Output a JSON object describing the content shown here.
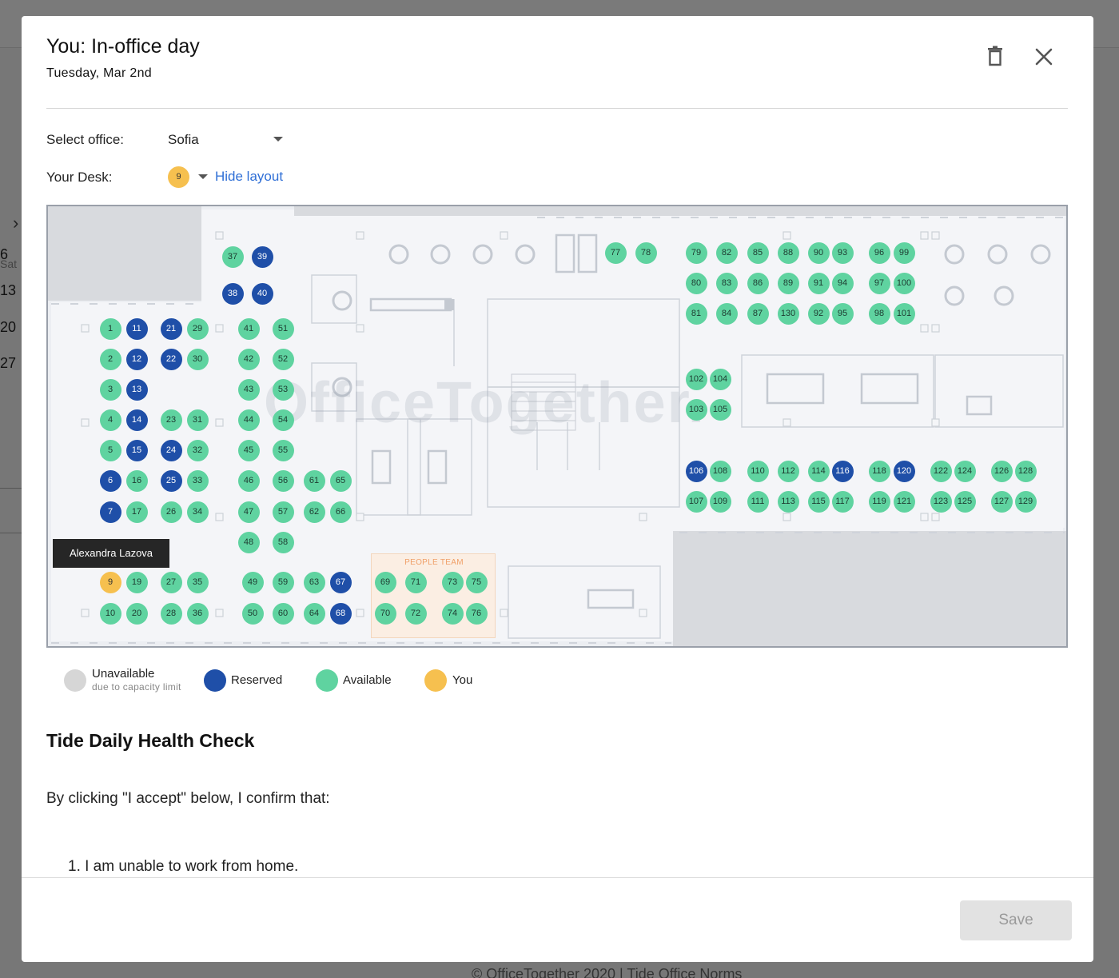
{
  "background": {
    "weekday": "Sat",
    "dates": [
      "6",
      "13",
      "20",
      "27"
    ],
    "footer": "© OfficeTogether 2020 | Tide Office Norms"
  },
  "modal": {
    "title": "You: In-office day",
    "date": "Tuesday, Mar 2nd",
    "office_label": "Select office:",
    "office_value": "Sofia",
    "desk_label": "Your Desk:",
    "desk_value": "9",
    "hide_layout": "Hide layout"
  },
  "floorplan": {
    "watermark": "OfficeTogether.",
    "area_label": "PEOPLE TEAM",
    "tooltip": "Alexandra Lazova",
    "desks": [
      {
        "n": "37",
        "s": "available"
      },
      {
        "n": "39",
        "s": "reserved"
      },
      {
        "n": "38",
        "s": "reserved"
      },
      {
        "n": "40",
        "s": "reserved"
      },
      {
        "n": "1",
        "s": "available"
      },
      {
        "n": "11",
        "s": "reserved"
      },
      {
        "n": "2",
        "s": "available"
      },
      {
        "n": "12",
        "s": "reserved"
      },
      {
        "n": "3",
        "s": "available"
      },
      {
        "n": "13",
        "s": "reserved"
      },
      {
        "n": "4",
        "s": "available"
      },
      {
        "n": "14",
        "s": "reserved"
      },
      {
        "n": "5",
        "s": "available"
      },
      {
        "n": "15",
        "s": "reserved"
      },
      {
        "n": "6",
        "s": "reserved"
      },
      {
        "n": "16",
        "s": "available"
      },
      {
        "n": "7",
        "s": "reserved"
      },
      {
        "n": "17",
        "s": "available"
      },
      {
        "n": "9",
        "s": "you"
      },
      {
        "n": "19",
        "s": "available"
      },
      {
        "n": "10",
        "s": "available"
      },
      {
        "n": "20",
        "s": "available"
      },
      {
        "n": "21",
        "s": "reserved"
      },
      {
        "n": "29",
        "s": "available"
      },
      {
        "n": "22",
        "s": "reserved"
      },
      {
        "n": "30",
        "s": "available"
      },
      {
        "n": "23",
        "s": "available"
      },
      {
        "n": "31",
        "s": "available"
      },
      {
        "n": "24",
        "s": "reserved"
      },
      {
        "n": "32",
        "s": "available"
      },
      {
        "n": "25",
        "s": "reserved"
      },
      {
        "n": "33",
        "s": "available"
      },
      {
        "n": "26",
        "s": "available"
      },
      {
        "n": "34",
        "s": "available"
      },
      {
        "n": "27",
        "s": "available"
      },
      {
        "n": "35",
        "s": "available"
      },
      {
        "n": "28",
        "s": "available"
      },
      {
        "n": "36",
        "s": "available"
      },
      {
        "n": "41",
        "s": "available"
      },
      {
        "n": "51",
        "s": "available"
      },
      {
        "n": "42",
        "s": "available"
      },
      {
        "n": "52",
        "s": "available"
      },
      {
        "n": "43",
        "s": "available"
      },
      {
        "n": "53",
        "s": "available"
      },
      {
        "n": "44",
        "s": "available"
      },
      {
        "n": "54",
        "s": "available"
      },
      {
        "n": "45",
        "s": "available"
      },
      {
        "n": "55",
        "s": "available"
      },
      {
        "n": "46",
        "s": "available"
      },
      {
        "n": "56",
        "s": "available"
      },
      {
        "n": "47",
        "s": "available"
      },
      {
        "n": "57",
        "s": "available"
      },
      {
        "n": "48",
        "s": "available"
      },
      {
        "n": "58",
        "s": "available"
      },
      {
        "n": "49",
        "s": "available"
      },
      {
        "n": "59",
        "s": "available"
      },
      {
        "n": "50",
        "s": "available"
      },
      {
        "n": "60",
        "s": "available"
      },
      {
        "n": "61",
        "s": "available"
      },
      {
        "n": "65",
        "s": "available"
      },
      {
        "n": "62",
        "s": "available"
      },
      {
        "n": "66",
        "s": "available"
      },
      {
        "n": "63",
        "s": "available"
      },
      {
        "n": "67",
        "s": "reserved"
      },
      {
        "n": "64",
        "s": "available"
      },
      {
        "n": "68",
        "s": "reserved"
      },
      {
        "n": "69",
        "s": "available"
      },
      {
        "n": "71",
        "s": "available"
      },
      {
        "n": "70",
        "s": "available"
      },
      {
        "n": "72",
        "s": "available"
      },
      {
        "n": "73",
        "s": "available"
      },
      {
        "n": "75",
        "s": "available"
      },
      {
        "n": "74",
        "s": "available"
      },
      {
        "n": "76",
        "s": "available"
      },
      {
        "n": "77",
        "s": "available"
      },
      {
        "n": "78",
        "s": "available"
      },
      {
        "n": "79",
        "s": "available"
      },
      {
        "n": "82",
        "s": "available"
      },
      {
        "n": "80",
        "s": "available"
      },
      {
        "n": "83",
        "s": "available"
      },
      {
        "n": "81",
        "s": "available"
      },
      {
        "n": "84",
        "s": "available"
      },
      {
        "n": "85",
        "s": "available"
      },
      {
        "n": "88",
        "s": "available"
      },
      {
        "n": "86",
        "s": "available"
      },
      {
        "n": "89",
        "s": "available"
      },
      {
        "n": "87",
        "s": "available"
      },
      {
        "n": "130",
        "s": "available"
      },
      {
        "n": "90",
        "s": "available"
      },
      {
        "n": "93",
        "s": "available"
      },
      {
        "n": "91",
        "s": "available"
      },
      {
        "n": "94",
        "s": "available"
      },
      {
        "n": "92",
        "s": "available"
      },
      {
        "n": "95",
        "s": "available"
      },
      {
        "n": "96",
        "s": "available"
      },
      {
        "n": "99",
        "s": "available"
      },
      {
        "n": "97",
        "s": "available"
      },
      {
        "n": "100",
        "s": "available"
      },
      {
        "n": "98",
        "s": "available"
      },
      {
        "n": "101",
        "s": "available"
      },
      {
        "n": "102",
        "s": "available"
      },
      {
        "n": "104",
        "s": "available"
      },
      {
        "n": "103",
        "s": "available"
      },
      {
        "n": "105",
        "s": "available"
      },
      {
        "n": "106",
        "s": "reserved"
      },
      {
        "n": "108",
        "s": "available"
      },
      {
        "n": "107",
        "s": "available"
      },
      {
        "n": "109",
        "s": "available"
      },
      {
        "n": "110",
        "s": "available"
      },
      {
        "n": "112",
        "s": "available"
      },
      {
        "n": "111",
        "s": "available"
      },
      {
        "n": "113",
        "s": "available"
      },
      {
        "n": "114",
        "s": "available"
      },
      {
        "n": "116",
        "s": "reserved"
      },
      {
        "n": "115",
        "s": "available"
      },
      {
        "n": "117",
        "s": "available"
      },
      {
        "n": "118",
        "s": "available"
      },
      {
        "n": "120",
        "s": "reserved"
      },
      {
        "n": "119",
        "s": "available"
      },
      {
        "n": "121",
        "s": "available"
      },
      {
        "n": "122",
        "s": "available"
      },
      {
        "n": "124",
        "s": "available"
      },
      {
        "n": "123",
        "s": "available"
      },
      {
        "n": "125",
        "s": "available"
      },
      {
        "n": "126",
        "s": "available"
      },
      {
        "n": "128",
        "s": "available"
      },
      {
        "n": "127",
        "s": "available"
      },
      {
        "n": "129",
        "s": "available"
      }
    ]
  },
  "legend": {
    "unavailable": "Unavailable",
    "unavailable_sub": "due to capacity limit",
    "reserved": "Reserved",
    "available": "Available",
    "you": "You",
    "colors": {
      "unavailable": "#d6d6d6",
      "reserved": "#1f4fa8",
      "available": "#5fd3a0",
      "you": "#f6c04f"
    }
  },
  "health_check": {
    "title": "Tide Daily Health Check",
    "intro": "By clicking \"I accept\" below, I confirm that:",
    "item_1": "1. I am unable to work from home."
  },
  "footer": {
    "save_label": "Save"
  }
}
